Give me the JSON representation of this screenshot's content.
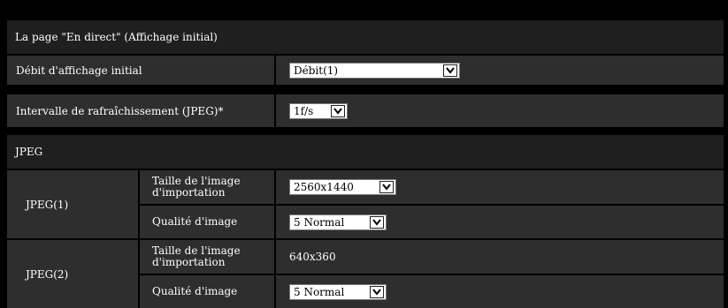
{
  "live_page": {
    "header": "La page \"En direct\" (Affichage initial)",
    "rows": [
      {
        "label": "Débit d'affichage initial",
        "value": "Débit(1)"
      },
      {
        "label": "Intervalle de rafraîchissement (JPEG)*",
        "value": "1f/s"
      }
    ]
  },
  "jpeg": {
    "header": "JPEG",
    "streams": [
      {
        "name": "JPEG(1)",
        "size_label": "Taille de l'image d'importation",
        "size_value": "2560x1440",
        "quality_label": "Qualité d'image",
        "quality_value": "5 Normal"
      },
      {
        "name": "JPEG(2)",
        "size_label": "Taille de l'image d'importation",
        "size_value": "640x360",
        "quality_label": "Qualité d'image",
        "quality_value": "5 Normal"
      }
    ]
  },
  "icons": {
    "dropdown": "chevron-down-icon"
  }
}
